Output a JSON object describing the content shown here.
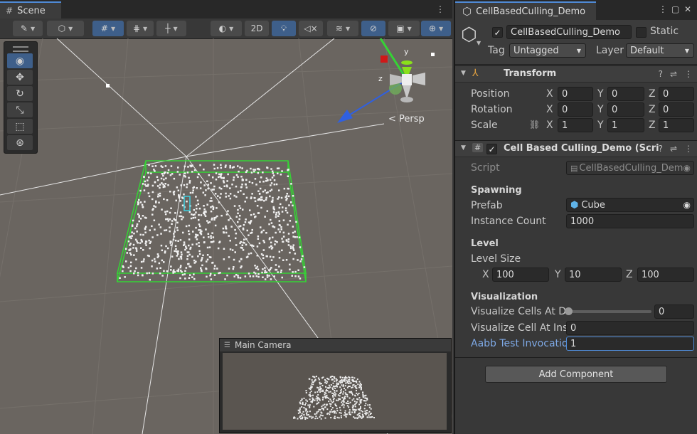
{
  "scene": {
    "tab_label": "Scene",
    "toolbar": {
      "mode_2d": "2D"
    },
    "gizmo": {
      "projection": "Persp",
      "y_axis": "y",
      "z_axis": "z"
    },
    "camera_preview": {
      "title": "Main Camera"
    }
  },
  "inspector": {
    "tab_label": "CellBasedCulling_Demo",
    "object": {
      "name": "CellBasedCulling_Demo",
      "active": true,
      "static_label": "Static",
      "tag_label": "Tag",
      "tag_value": "Untagged",
      "layer_label": "Layer",
      "layer_value": "Default"
    },
    "transform": {
      "title": "Transform",
      "position_label": "Position",
      "rotation_label": "Rotation",
      "scale_label": "Scale",
      "axis_x": "X",
      "axis_y": "Y",
      "axis_z": "Z",
      "position": {
        "x": "0",
        "y": "0",
        "z": "0"
      },
      "rotation": {
        "x": "0",
        "y": "0",
        "z": "0"
      },
      "scale": {
        "x": "1",
        "y": "1",
        "z": "1"
      }
    },
    "script_component": {
      "title": "Cell Based Culling_Demo (Scri",
      "script_label": "Script",
      "script_value": "CellBasedCulling_Dem",
      "spawning_header": "Spawning",
      "prefab_label": "Prefab",
      "prefab_value": "Cube",
      "instance_count_label": "Instance Count",
      "instance_count_value": "1000",
      "level_header": "Level",
      "level_size_label": "Level Size",
      "level_size": {
        "x": "100",
        "y": "10",
        "z": "100"
      },
      "visualization_header": "Visualization",
      "visualize_cells_label": "Visualize Cells At De",
      "visualize_cells_value": "0",
      "visualize_cell_inst_label": "Visualize Cell At Inst",
      "visualize_cell_inst_value": "0",
      "aabb_label": "Aabb Test Invocatio",
      "aabb_value": "1"
    },
    "add_component_label": "Add Component"
  },
  "colors": {
    "scene_bg": "#6a6560",
    "selection_green": "#35d435",
    "accent_blue": "#4f8ad6",
    "panel_bg": "#383838"
  }
}
